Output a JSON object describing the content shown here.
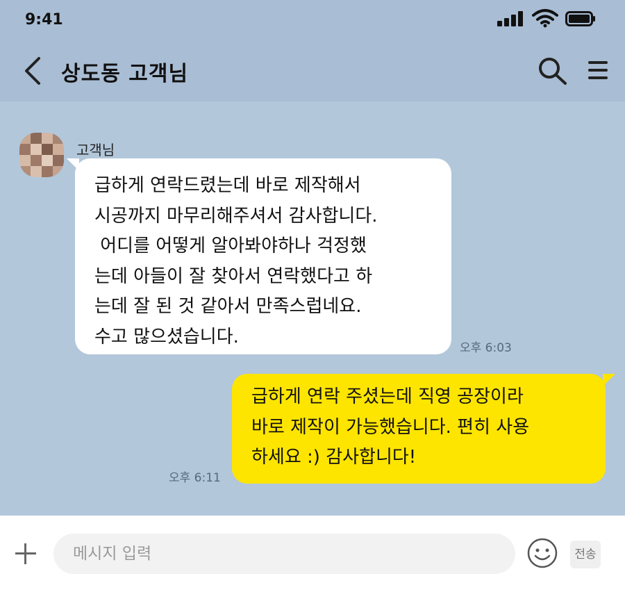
{
  "status_bar": {
    "time": "9:41"
  },
  "header": {
    "title": "상도동 고객님"
  },
  "messages": [
    {
      "direction": "incoming",
      "sender": "고객님",
      "lines": [
        "급하게 연락드렸는데 바로 제작해서",
        "시공까지 마무리해주셔서 감사합니다.",
        " 어디를 어떻게 알아봐야하나 걱정했",
        "는데 아들이 잘 찾아서 연락했다고 하",
        "는데 잘 된 것 같아서 만족스럽네요.",
        "수고 많으셨습니다."
      ],
      "time": "오후 6:03"
    },
    {
      "direction": "outgoing",
      "lines": [
        "급하게 연락 주셨는데 직영 공장이라",
        "바로 제작이 가능했습니다. 편히 사용",
        "하세요 :) 감사합니다!"
      ],
      "time": "오후 6:11"
    }
  ],
  "input": {
    "placeholder": "메시지 입력",
    "value": "",
    "send_label": "전송"
  },
  "colors": {
    "header_bg": "#a9bdd4",
    "chat_bg": "#b2c7da",
    "incoming_bubble": "#ffffff",
    "outgoing_bubble": "#fee500"
  },
  "icons": {
    "back": "chevron-left-icon",
    "search": "search-icon",
    "menu": "hamburger-menu-icon",
    "add": "plus-icon",
    "emoji": "smiley-icon"
  }
}
